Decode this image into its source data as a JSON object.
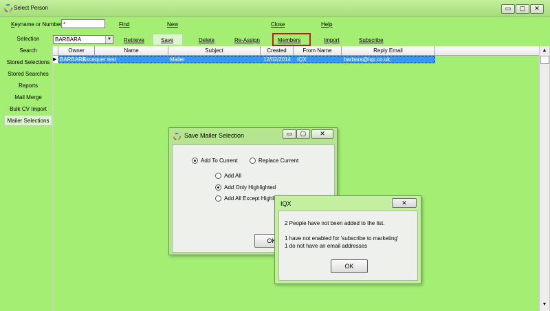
{
  "window": {
    "title": "Select Person",
    "controls": [
      "▭",
      "▢",
      "✕"
    ]
  },
  "topbar": {
    "keyname_label": "Keyname or Number",
    "keyname_value": "*",
    "find": "Find",
    "new": "New",
    "close": "Close",
    "help": "Help"
  },
  "sidebar": {
    "items": [
      {
        "label": "Selection"
      },
      {
        "label": "Search"
      },
      {
        "label": "Stored Selections"
      },
      {
        "label": "Stored Searches"
      },
      {
        "label": "Reports"
      },
      {
        "label": "Mail Merge"
      },
      {
        "label": "Bulk CV Import"
      },
      {
        "label": "Mailer Selections"
      }
    ]
  },
  "toolbar": {
    "selection_value": "BARBARA",
    "retrieve": "Retrieve",
    "save": "Save",
    "delete": "Delete",
    "reassign": "Re-Assign",
    "members": "Members",
    "import": "Import",
    "subscribe": "Subscribe"
  },
  "grid": {
    "columns": [
      "Owner",
      "Name",
      "Subject",
      "Created",
      "From Name",
      "Reply Email"
    ],
    "rows": [
      [
        "BARBARA",
        "Excequer test",
        "Mailer",
        "12/02/2014",
        "IQX",
        "barbara@iqx.co.uk"
      ]
    ]
  },
  "mailer_dialog": {
    "title": "Save Mailer Selection",
    "add_to_current": "Add To Current",
    "replace_current": "Replace Current",
    "add_all": "Add All",
    "add_only_highlighted": "Add Only Highlighted",
    "add_all_except": "Add All Except Highlig",
    "ok": "OK"
  },
  "iqx_dialog": {
    "title": "IQX",
    "line1": "2 People have not been added to the list.",
    "line2": "1 have not enabled for 'subscribe to marketing'",
    "line3": "1 do not have an email addresses",
    "ok": "OK"
  }
}
